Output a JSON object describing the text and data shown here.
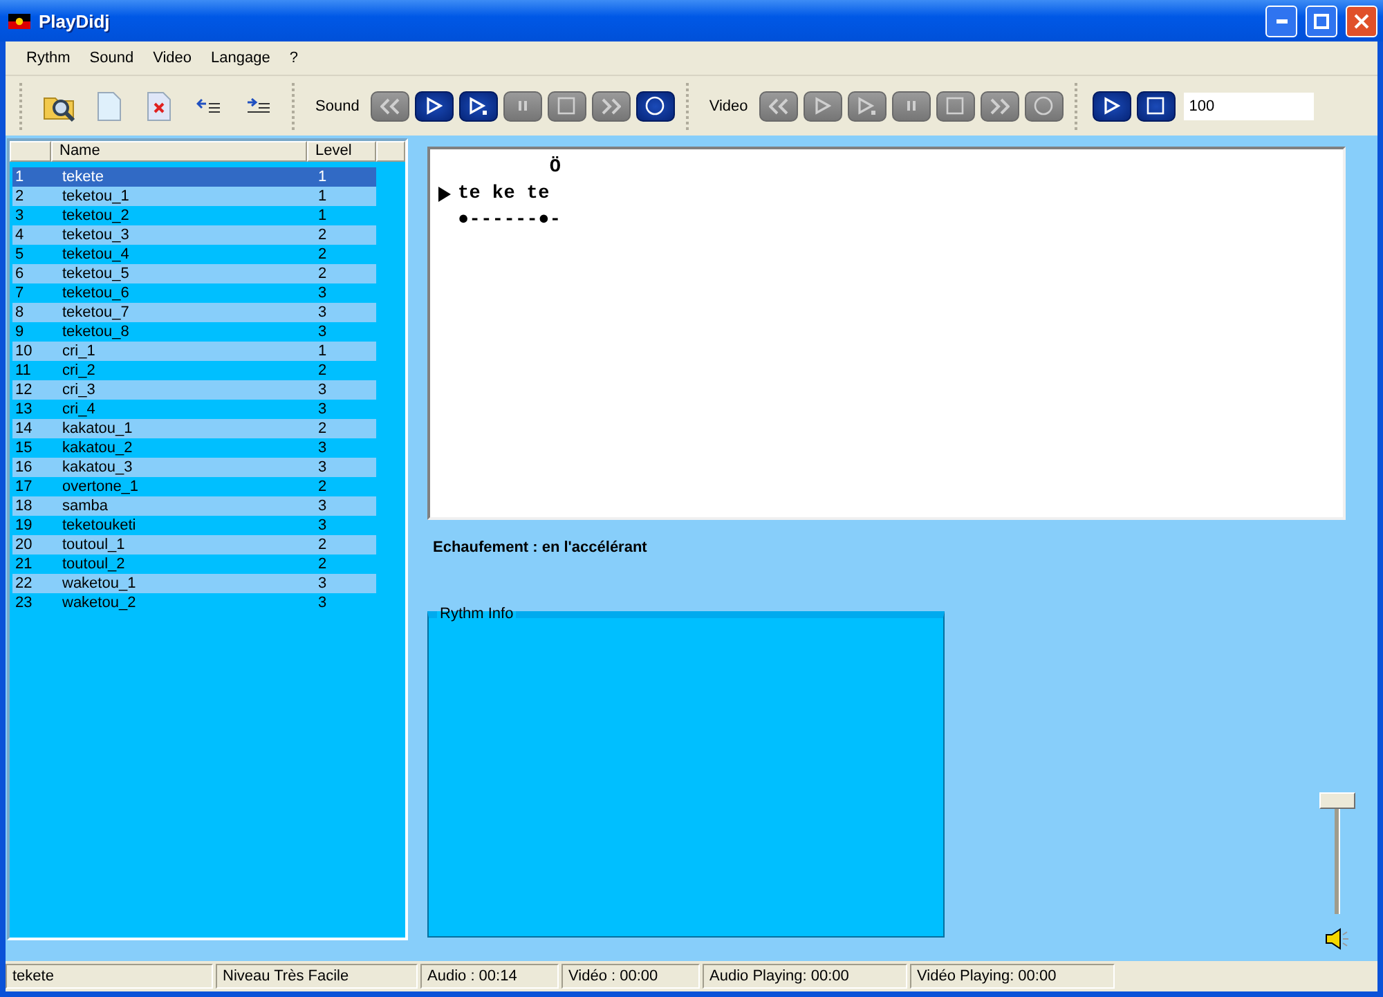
{
  "window": {
    "title": "PlayDidj"
  },
  "menu": [
    "Rythm",
    "Sound",
    "Video",
    "Langage",
    "?"
  ],
  "file_tools": [
    {
      "kind": "open"
    },
    {
      "kind": "new"
    },
    {
      "kind": "delete"
    },
    {
      "kind": "insert"
    },
    {
      "kind": "remove"
    }
  ],
  "sound_controls": {
    "label": "Sound",
    "buttons": [
      {
        "kind": "rewind",
        "enabled": false
      },
      {
        "kind": "play",
        "enabled": true
      },
      {
        "kind": "step",
        "enabled": true
      },
      {
        "kind": "pause",
        "enabled": false
      },
      {
        "kind": "stop",
        "enabled": false
      },
      {
        "kind": "forward",
        "enabled": false
      },
      {
        "kind": "record",
        "enabled": true
      }
    ]
  },
  "video_controls": {
    "label": "Video",
    "buttons": [
      {
        "kind": "rewind",
        "enabled": false
      },
      {
        "kind": "play",
        "enabled": false
      },
      {
        "kind": "step",
        "enabled": false
      },
      {
        "kind": "pause",
        "enabled": false
      },
      {
        "kind": "stop",
        "enabled": false
      },
      {
        "kind": "forward",
        "enabled": false
      },
      {
        "kind": "record",
        "enabled": false
      }
    ]
  },
  "tempo_controls": {
    "buttons": [
      {
        "kind": "play",
        "enabled": true
      },
      {
        "kind": "stop",
        "enabled": true
      }
    ],
    "value": "100"
  },
  "table": {
    "columns": [
      "Name",
      "Level"
    ],
    "rows": [
      {
        "index": "1",
        "name": "tekete",
        "level": "1",
        "selected": true
      },
      {
        "index": "2",
        "name": "teketou_1",
        "level": "1",
        "selected": false
      },
      {
        "index": "3",
        "name": "teketou_2",
        "level": "1",
        "selected": false
      },
      {
        "index": "4",
        "name": "teketou_3",
        "level": "2",
        "selected": false
      },
      {
        "index": "5",
        "name": "teketou_4",
        "level": "2",
        "selected": false
      },
      {
        "index": "6",
        "name": "teketou_5",
        "level": "2",
        "selected": false
      },
      {
        "index": "7",
        "name": "teketou_6",
        "level": "3",
        "selected": false
      },
      {
        "index": "8",
        "name": "teketou_7",
        "level": "3",
        "selected": false
      },
      {
        "index": "9",
        "name": "teketou_8",
        "level": "3",
        "selected": false
      },
      {
        "index": "10",
        "name": "cri_1",
        "level": "1",
        "selected": false
      },
      {
        "index": "11",
        "name": "cri_2",
        "level": "2",
        "selected": false
      },
      {
        "index": "12",
        "name": "cri_3",
        "level": "3",
        "selected": false
      },
      {
        "index": "13",
        "name": "cri_4",
        "level": "3",
        "selected": false
      },
      {
        "index": "14",
        "name": "kakatou_1",
        "level": "2",
        "selected": false
      },
      {
        "index": "15",
        "name": "kakatou_2",
        "level": "3",
        "selected": false
      },
      {
        "index": "16",
        "name": "kakatou_3",
        "level": "3",
        "selected": false
      },
      {
        "index": "17",
        "name": "overtone_1",
        "level": "2",
        "selected": false
      },
      {
        "index": "18",
        "name": "samba",
        "level": "3",
        "selected": false
      },
      {
        "index": "19",
        "name": "teketouketi",
        "level": "3",
        "selected": false
      },
      {
        "index": "20",
        "name": "toutoul_1",
        "level": "2",
        "selected": false
      },
      {
        "index": "21",
        "name": "toutoul_2",
        "level": "2",
        "selected": false
      },
      {
        "index": "22",
        "name": "waketou_1",
        "level": "3",
        "selected": false
      },
      {
        "index": "23",
        "name": "waketou_2",
        "level": "3",
        "selected": false
      }
    ]
  },
  "notation": {
    "lines": [
      {
        "text": "        Ö",
        "current": false
      },
      {
        "text": "te ke te",
        "current": true
      },
      {
        "text": "●------●-",
        "current": false
      }
    ]
  },
  "caption": "Echaufement : en l'accélérant",
  "rythm_info": {
    "title": "Rythm Info"
  },
  "volume": {
    "level": 1
  },
  "status_bar": [
    "tekete",
    "Niveau Très Facile",
    "Audio : 00:14",
    "Vidéo : 00:00",
    "Audio Playing: 00:00",
    "Vidéo Playing: 00:00"
  ]
}
